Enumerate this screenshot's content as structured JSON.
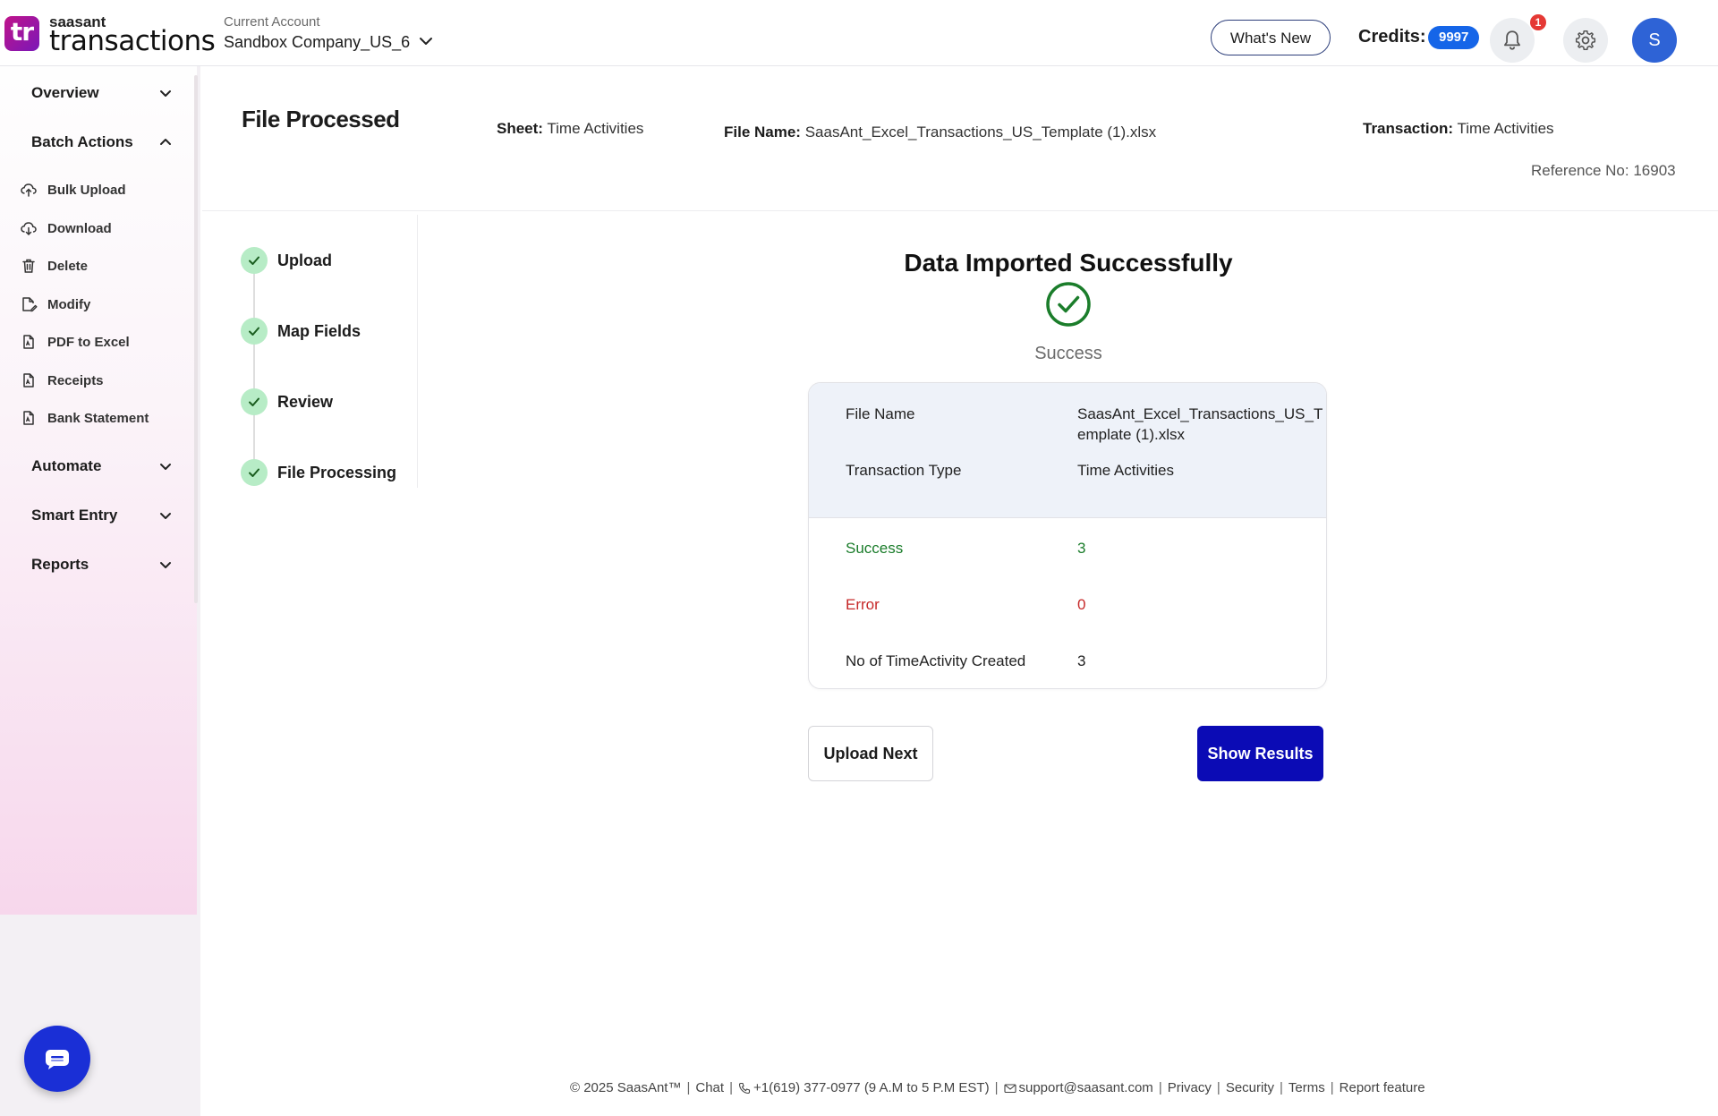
{
  "header": {
    "logo_mark": "tr",
    "logo_small": "saasant",
    "logo_big": "transactions",
    "account_label": "Current Account",
    "account_name": "Sandbox Company_US_6",
    "whats_new": "What's New",
    "credits_label": "Credits:",
    "credits_value": "9997",
    "notification_count": "1",
    "avatar_initial": "S",
    "icons": [
      "chevron-down-icon",
      "bell-icon",
      "gear-icon"
    ]
  },
  "sidebar": {
    "groups": [
      {
        "label": "Overview",
        "expanded": false
      },
      {
        "label": "Batch Actions",
        "expanded": true
      },
      {
        "label": "Automate",
        "expanded": false
      },
      {
        "label": "Smart Entry",
        "expanded": false
      },
      {
        "label": "Reports",
        "expanded": false
      }
    ],
    "batch_items": [
      {
        "label": "Bulk Upload",
        "icon": "cloud-upload-icon"
      },
      {
        "label": "Download",
        "icon": "cloud-download-icon"
      },
      {
        "label": "Delete",
        "icon": "trash-icon"
      },
      {
        "label": "Modify",
        "icon": "edit-file-icon"
      },
      {
        "label": "PDF to Excel",
        "icon": "pdf-file-icon"
      },
      {
        "label": "Receipts",
        "icon": "receipt-file-icon"
      },
      {
        "label": "Bank Statement",
        "icon": "statement-file-icon"
      }
    ]
  },
  "page": {
    "title": "File Processed",
    "sheet_label": "Sheet:",
    "sheet_value": "Time Activities",
    "file_name_label": "File Name:",
    "file_name_value": "SaasAnt_Excel_Transactions_US_Template (1).xlsx",
    "transaction_label": "Transaction:",
    "transaction_value": "Time Activities",
    "reference": "Reference No: 16903"
  },
  "steps": [
    {
      "label": "Upload",
      "done": true
    },
    {
      "label": "Map Fields",
      "done": true
    },
    {
      "label": "Review",
      "done": true
    },
    {
      "label": "File Processing",
      "done": true
    }
  ],
  "result": {
    "title": "Data Imported Successfully",
    "status": "Success",
    "rows": {
      "file_name_label": "File Name",
      "file_name_value_line1": "SaasAnt_Excel_Transactions_US_T",
      "file_name_value_line2": "emplate (1).xlsx",
      "transaction_type_label": "Transaction Type",
      "transaction_type_value": "Time Activities",
      "success_label": "Success",
      "success_value": "3",
      "error_label": "Error",
      "error_value": "0",
      "created_label": "No of TimeActivity Created",
      "created_value": "3"
    },
    "upload_next": "Upload Next",
    "show_results": "Show Results"
  },
  "colors": {
    "accent_blue": "#0b0bb5",
    "success_green": "#1b7d2b",
    "error_red": "#c62828",
    "credits_badge": "#1565e8"
  },
  "footer": {
    "copyright": "© 2025 SaasAnt™",
    "chat": "Chat",
    "phone": "+1(619) 377-0977 (9 A.M to 5 P.M EST)",
    "email": "support@saasant.com",
    "privacy": "Privacy",
    "security": "Security",
    "terms": "Terms",
    "report": "Report feature"
  }
}
